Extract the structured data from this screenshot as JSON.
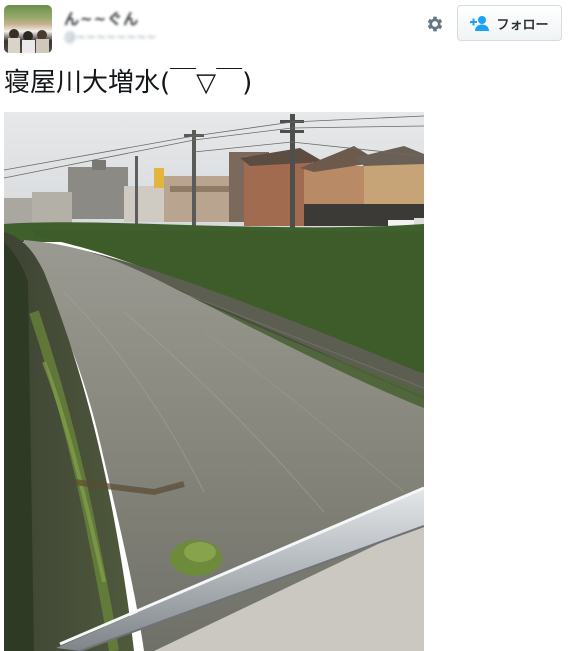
{
  "tweet": {
    "author_name": "ん~~ぐん",
    "author_handle": "@~~~~~~~~",
    "text": "寝屋川大増水(￣▽￣)",
    "follow_label": "フォロー"
  },
  "icons": {
    "avatar": "avatar-photo",
    "settings": "gear-icon",
    "follow": "person-add-icon"
  },
  "colors": {
    "follow_icon": "#1da1f2",
    "gear": "#657786"
  }
}
